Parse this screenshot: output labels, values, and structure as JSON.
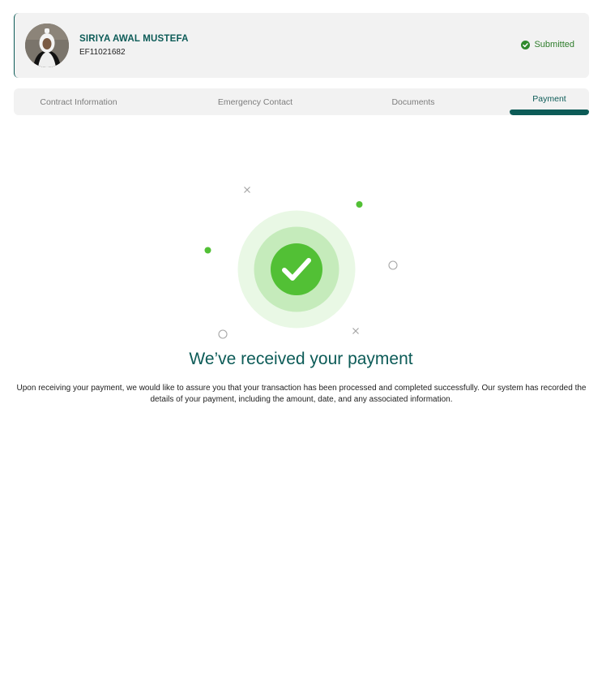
{
  "profile": {
    "name": "SIRIYA AWAL MUSTEFA",
    "id": "EF11021682",
    "status": "Submitted",
    "status_icon": "check-circle-icon"
  },
  "tabs": [
    {
      "label": "Contract Information",
      "active": false
    },
    {
      "label": "Emergency Contact",
      "active": false
    },
    {
      "label": "Documents",
      "active": false
    },
    {
      "label": "Payment",
      "active": true
    }
  ],
  "success": {
    "title": "We’ve received your payment",
    "message": "Upon receiving your payment, we would like to assure you that your transaction has been processed and completed successfully. Our system has recorded the details of your payment, including the amount, date, and any associated information.",
    "icon": "checkmark-icon"
  },
  "colors": {
    "brand": "#0c5b57",
    "success_green": "#52c035",
    "success_light": "#c5ebbb",
    "success_lighter": "#e9f8e5"
  }
}
